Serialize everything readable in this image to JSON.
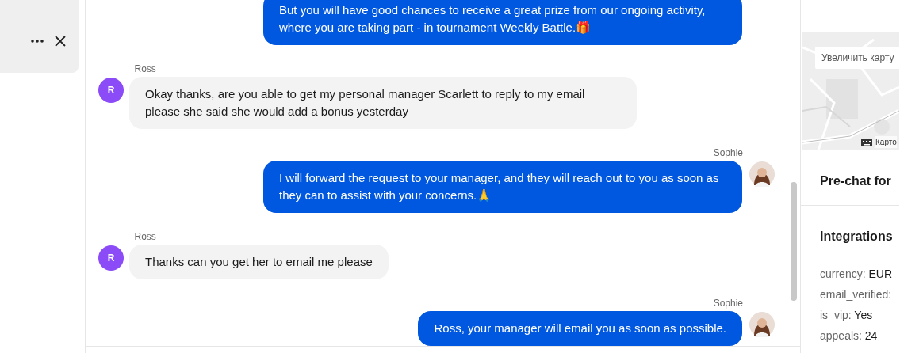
{
  "messages": [
    {
      "kind": "agent",
      "text": "But you will have good chances to receive a great prize from our ongoing activity, where you are taking part - in tournament Weekly Battle.🎁"
    },
    {
      "kind": "client",
      "sender": "Ross",
      "avatar_letter": "R",
      "text": "Okay thanks, are you able to get my personal manager Scarlett to reply to my email please she said she would add a bonus yesterday"
    },
    {
      "kind": "agent",
      "sender": "Sophie",
      "text": "I will forward the request to your manager, and they will reach out to you as soon as they can to assist with your concerns.🙏"
    },
    {
      "kind": "client",
      "sender": "Ross",
      "avatar_letter": "R",
      "text": "Thanks can you get her to email me please"
    },
    {
      "kind": "agent",
      "sender": "Sophie",
      "text": "Ross, your manager will email you as soon as possible."
    }
  ],
  "map": {
    "enlarge_button": "Увеличить карту",
    "attribution": "Карто"
  },
  "sections": [
    {
      "title": "Pre-chat for"
    },
    {
      "title": "Integrations"
    }
  ],
  "integrations": [
    {
      "key": "currency:",
      "value": "EUR"
    },
    {
      "key": "email_verified:"
    },
    {
      "key": "is_vip:",
      "value": "Yes"
    },
    {
      "key": "appeals:",
      "value": "24"
    }
  ]
}
